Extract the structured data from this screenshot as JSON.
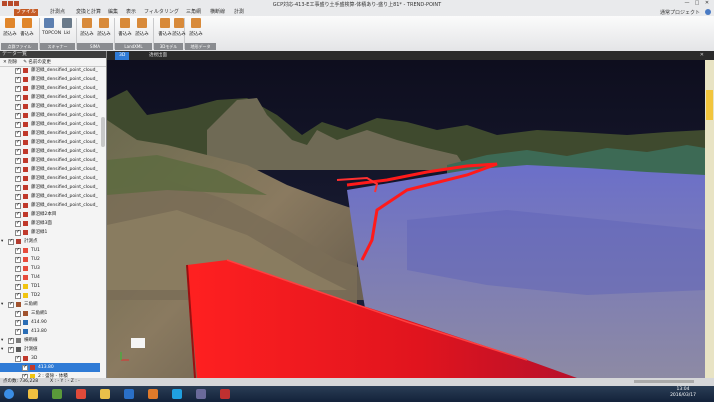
{
  "window": {
    "title": "GCP対応-413-E工事盛り土手盛検算-体積あり-盛り上81* - TREND-POINT",
    "controls": [
      "—",
      "□",
      "✕"
    ]
  },
  "menu": {
    "tabs": [
      "ファイル",
      "計測点",
      "変換と計算",
      "編集",
      "表示",
      "フィルタリング",
      "三角網",
      "横断線",
      "計測"
    ],
    "project_label": "通常プロジェクト",
    "help_icon": "help-icon"
  },
  "ribbon": {
    "buttons": [
      {
        "label": "読込み",
        "icon": "txt-file-icon",
        "color": "#e0862b"
      },
      {
        "label": "書込み",
        "icon": "txt-save-icon",
        "color": "#e0862b"
      },
      {
        "label": "TOPCON",
        "icon": "scanner-icon",
        "color": "#5c7fb0"
      },
      {
        "label": "Lkl",
        "icon": "scanner2-icon",
        "color": "#6a7a8a"
      },
      {
        "label": "読込み",
        "icon": "sima-icon",
        "color": "#d88a3a"
      },
      {
        "label": "読込み",
        "icon": "las-icon",
        "color": "#d88a3a"
      },
      {
        "label": "書込み",
        "icon": "las-save-icon",
        "color": "#d88a3a"
      },
      {
        "label": "読込み",
        "icon": "landxml-icon",
        "color": "#d88a3a"
      },
      {
        "label": "書込み",
        "icon": "landxml-save-icon",
        "color": "#d88a3a"
      },
      {
        "label": "読込み",
        "icon": "model-icon",
        "color": "#d88a3a"
      },
      {
        "label": "読込み",
        "icon": "dem-icon",
        "color": "#d88a3a"
      }
    ],
    "groups": [
      "点群ファイル",
      "スキャナー",
      "SIMA",
      "LandXML",
      "3Dモデル",
      "地形データ"
    ]
  },
  "panel": {
    "title": "データ一覧",
    "toolbar": {
      "delete": "削除",
      "rename": "名前の変更"
    },
    "rows": [
      {
        "label": "藤沼緑_densified_point_cloud_",
        "level": 2,
        "checked": true,
        "swatch": "#c0392b"
      },
      {
        "label": "藤沼緑_densified_point_cloud_",
        "level": 2,
        "checked": true,
        "swatch": "#c0392b"
      },
      {
        "label": "藤沼緑_densified_point_cloud_",
        "level": 2,
        "checked": true,
        "swatch": "#c0392b"
      },
      {
        "label": "藤沼緑_densified_point_cloud_",
        "level": 2,
        "checked": true,
        "swatch": "#c0392b"
      },
      {
        "label": "藤沼緑_densified_point_cloud_",
        "level": 2,
        "checked": true,
        "swatch": "#c0392b"
      },
      {
        "label": "藤沼緑_densified_point_cloud_",
        "level": 2,
        "checked": true,
        "swatch": "#c0392b"
      },
      {
        "label": "藤沼緑_densified_point_cloud_",
        "level": 2,
        "checked": true,
        "swatch": "#c0392b"
      },
      {
        "label": "藤沼緑_densified_point_cloud_",
        "level": 2,
        "checked": true,
        "swatch": "#c0392b"
      },
      {
        "label": "藤沼緑_densified_point_cloud_",
        "level": 2,
        "checked": true,
        "swatch": "#c0392b"
      },
      {
        "label": "藤沼緑_densified_point_cloud_",
        "level": 2,
        "checked": true,
        "swatch": "#c0392b"
      },
      {
        "label": "藤沼緑_densified_point_cloud_",
        "level": 2,
        "checked": true,
        "swatch": "#c0392b"
      },
      {
        "label": "藤沼緑_densified_point_cloud_",
        "level": 2,
        "checked": true,
        "swatch": "#c0392b"
      },
      {
        "label": "藤沼緑_densified_point_cloud_",
        "level": 2,
        "checked": true,
        "swatch": "#c0392b"
      },
      {
        "label": "藤沼緑_densified_point_cloud_",
        "level": 2,
        "checked": true,
        "swatch": "#c0392b"
      },
      {
        "label": "藤沼緑_densified_point_cloud_",
        "level": 2,
        "checked": true,
        "swatch": "#c0392b"
      },
      {
        "label": "藤沼緑_densified_point_cloud_",
        "level": 2,
        "checked": true,
        "swatch": "#c0392b"
      },
      {
        "label": "藤沼緑2本目",
        "level": 2,
        "checked": true,
        "swatch": "#c0392b"
      },
      {
        "label": "藤沼緑3面",
        "level": 2,
        "checked": true,
        "swatch": "#c0392b"
      },
      {
        "label": "藤沼緑1",
        "level": 2,
        "checked": true,
        "swatch": "#c0392b"
      },
      {
        "label": "計測点",
        "level": 1,
        "checked": true,
        "swatch": "#b03a2e"
      },
      {
        "label": "TU1",
        "level": 2,
        "checked": true,
        "swatch": "#e74c3c"
      },
      {
        "label": "TU2",
        "level": 2,
        "checked": true,
        "swatch": "#e74c3c"
      },
      {
        "label": "TU3",
        "level": 2,
        "checked": true,
        "swatch": "#e74c3c"
      },
      {
        "label": "TU4",
        "level": 2,
        "checked": true,
        "swatch": "#e74c3c"
      },
      {
        "label": "TD1",
        "level": 2,
        "checked": true,
        "swatch": "#f1c40f"
      },
      {
        "label": "TD2",
        "level": 2,
        "checked": true,
        "swatch": "#f1c40f"
      },
      {
        "label": "三角網",
        "level": 1,
        "checked": true,
        "swatch": "#a0522d"
      },
      {
        "label": "三角網1",
        "level": 2,
        "checked": true,
        "swatch": "#a0522d"
      },
      {
        "label": "414.90",
        "level": 2,
        "checked": true,
        "swatch": "#2a6db5"
      },
      {
        "label": "413.80",
        "level": 2,
        "checked": true,
        "swatch": "#2a6db5"
      },
      {
        "label": "横断線",
        "level": 1,
        "checked": true,
        "swatch": "#7a7a7a"
      },
      {
        "label": "計測値",
        "level": 1,
        "checked": true,
        "swatch": "#5a5a5a"
      },
      {
        "label": "3D",
        "level": 2,
        "checked": true,
        "swatch": "#c0392b"
      },
      {
        "label": "413.80",
        "level": 3,
        "checked": true,
        "swatch": "#c0392b",
        "selected": true
      },
      {
        "label": "2 : 盛除 - 体積",
        "level": 3,
        "checked": true,
        "swatch": "#f1c40f"
      }
    ]
  },
  "view_tabs": [
    {
      "label": "3D",
      "active": true
    },
    {
      "label": "透視出面",
      "active": false
    }
  ],
  "view_close": "✕",
  "status": {
    "points": "点の数: 736,228",
    "coords": "X : - Y : - Z : -"
  },
  "taskbar": {
    "time": "13:04",
    "date": "2016/03/17",
    "apps": [
      "start-icon",
      "explorer-icon",
      "media-icon",
      "chrome-icon",
      "folder-icon",
      "ie-icon",
      "firefox-icon",
      "skype-icon",
      "app-icon",
      "trend-point-icon"
    ]
  },
  "colors": {
    "accent": "#c45a24",
    "selection": "#2f7bd6",
    "design_surface": "#ff1a1a",
    "water_surface": "#6b6fc9"
  }
}
